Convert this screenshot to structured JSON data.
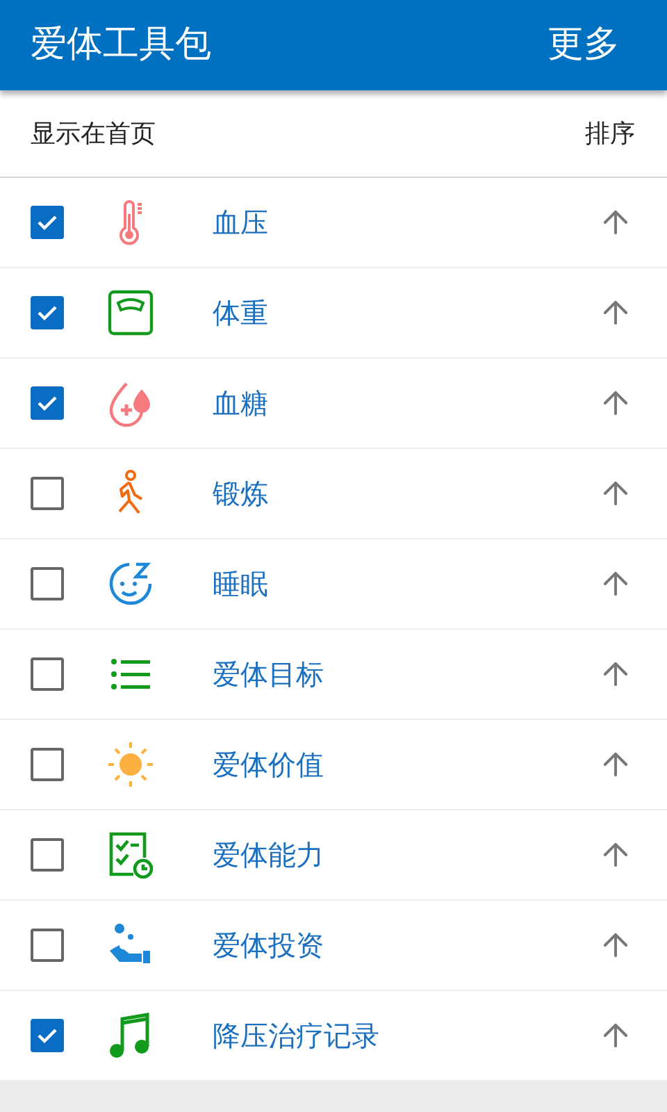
{
  "app_bar": {
    "title": "爱体工具包",
    "action": "更多"
  },
  "list_header": {
    "label": "显示在首页",
    "sort_label": "排序"
  },
  "items": [
    {
      "kind": "thermometer",
      "label": "血压",
      "checked": true
    },
    {
      "kind": "scale",
      "label": "体重",
      "checked": true
    },
    {
      "kind": "drops",
      "label": "血糖",
      "checked": true
    },
    {
      "kind": "walker",
      "label": "锻炼",
      "checked": false
    },
    {
      "kind": "sleep",
      "label": "睡眠",
      "checked": false
    },
    {
      "kind": "list",
      "label": "爱体目标",
      "checked": false
    },
    {
      "kind": "sun",
      "label": "爱体价值",
      "checked": false
    },
    {
      "kind": "checklist",
      "label": "爱体能力",
      "checked": false
    },
    {
      "kind": "hand",
      "label": "爱体投资",
      "checked": false
    },
    {
      "kind": "music",
      "label": "降压治疗记录",
      "checked": true
    }
  ]
}
